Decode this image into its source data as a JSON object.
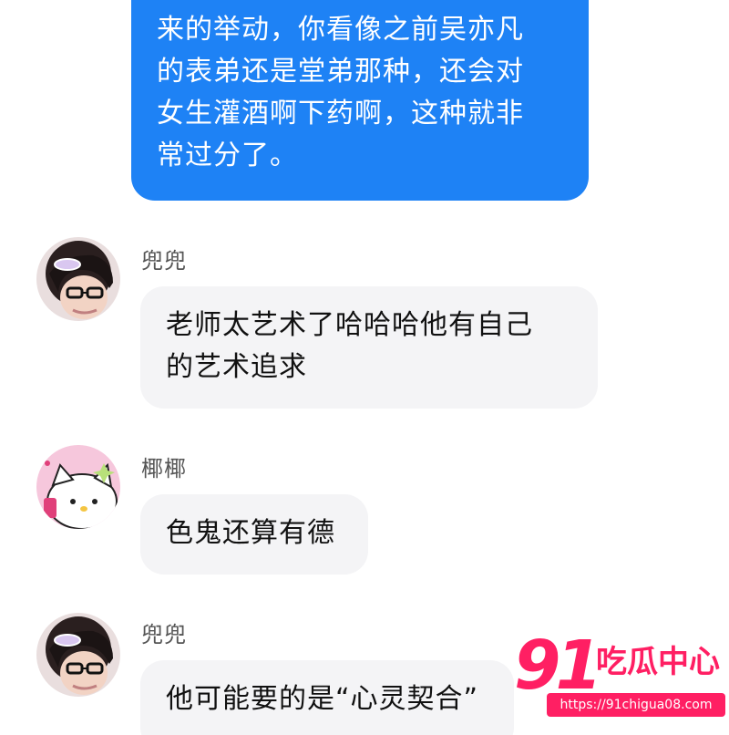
{
  "conversation": {
    "sent_message": {
      "text": "来的举动，你看像之前吴亦凡\n的表弟还是堂弟那种，还会对\n女生灌酒啊下药啊，这种就非\n常过分了。"
    },
    "messages": [
      {
        "sender": "兜兜",
        "avatar_icon": "user-avatar-glasses-icon",
        "text": "老师太艺术了哈哈哈他有自己\n的艺术追求"
      },
      {
        "sender": "椰椰",
        "avatar_icon": "hello-kitty-avatar-icon",
        "text": "色鬼还算有德"
      },
      {
        "sender": "兜兜",
        "avatar_icon": "user-avatar-glasses-icon",
        "text": "他可能要的是“心灵契合”"
      }
    ]
  },
  "watermark": {
    "number": "91",
    "chinese": "吃瓜中心",
    "url": "https://91chigua08.com"
  },
  "colors": {
    "sent_bubble": "#1e82f5",
    "received_bubble": "#f4f4f6",
    "watermark": "#ff1f63"
  }
}
